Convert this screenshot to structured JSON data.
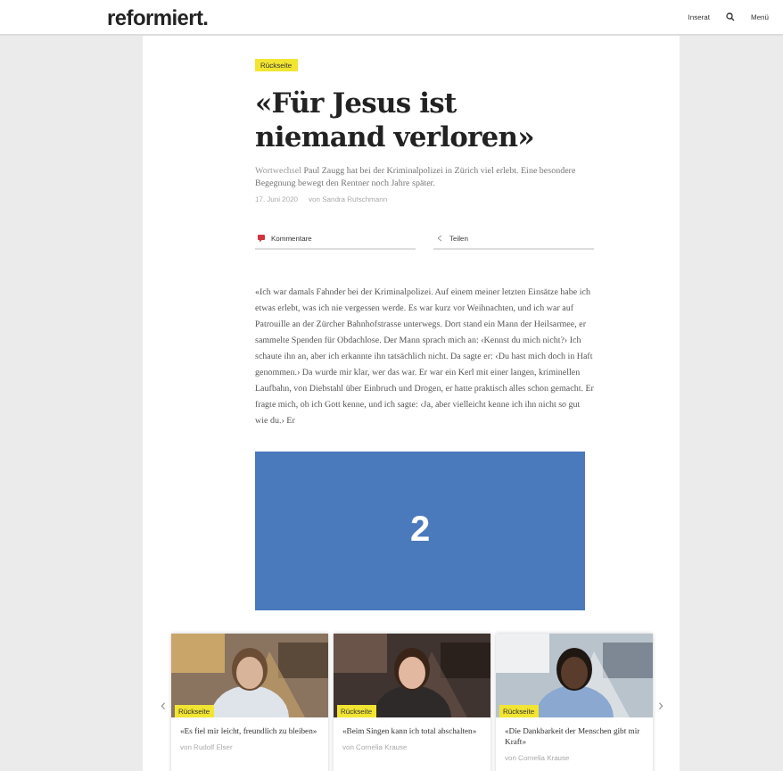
{
  "header": {
    "logo": "reformiert.",
    "links": [
      "Inserat",
      "Menü"
    ]
  },
  "article": {
    "tag": "Rückseite",
    "title": "«Für Jesus ist niemand verloren»",
    "lead_label": "Wortwechsel",
    "lead": "Paul Zaugg hat bei der Kriminalpolizei in Zürich viel erlebt. Eine besondere Begegnung bewegt den Rentner noch Jahre später.",
    "date": "17. Juni 2020",
    "author": "von Sandra Rutschmann",
    "actions": [
      {
        "kind": "comments",
        "label": "Kommentare"
      },
      {
        "kind": "share",
        "label": "Teilen"
      }
    ],
    "body": "«Ich war damals Fahnder bei der Kriminalpolizei. Auf einem meiner letzten Einsätze habe ich etwas erlebt, was ich nie vergessen werde. Es war kurz vor Weihnachten, und ich war auf Patrouille an der Zürcher Bahnhofstrasse unterwegs. Dort stand ein Mann der Heilsarmee, er sammelte Spenden für Obdachlose. Der Mann sprach mich an: ‹Kennst du mich nicht?› Ich schaute ihn an, aber ich erkannte ihn tatsächlich nicht. Da sagte er: ‹Du hast mich doch in Haft genommen.› Da wurde mir klar, wer das war. Er war ein Kerl mit einer langen, kriminellen Laufbahn, von Diebstahl über Einbruch und Drogen, er hatte praktisch alles schon gemacht. Er fragte mich, ob ich Gott kenne, und ich sagte: ‹Ja, aber vielleicht kenne ich ihn nicht so gut wie du.› Er"
  },
  "overlay": {
    "label": "2"
  },
  "related": {
    "prev": "‹",
    "next": "›",
    "cards": [
      {
        "tag": "Rückseite",
        "title": "«Es fiel mir leicht, freundlich zu bleiben»",
        "byline": "von Rudolf Elser"
      },
      {
        "tag": "Rückseite",
        "title": "«Beim Singen kann ich total abschalten»",
        "byline": "von Cornelia Krause"
      },
      {
        "tag": "Rückseite",
        "title": "«Die Dankbarkeit der Menschen gibt mir Kraft»",
        "byline": "von Cornelia Krause"
      }
    ]
  }
}
